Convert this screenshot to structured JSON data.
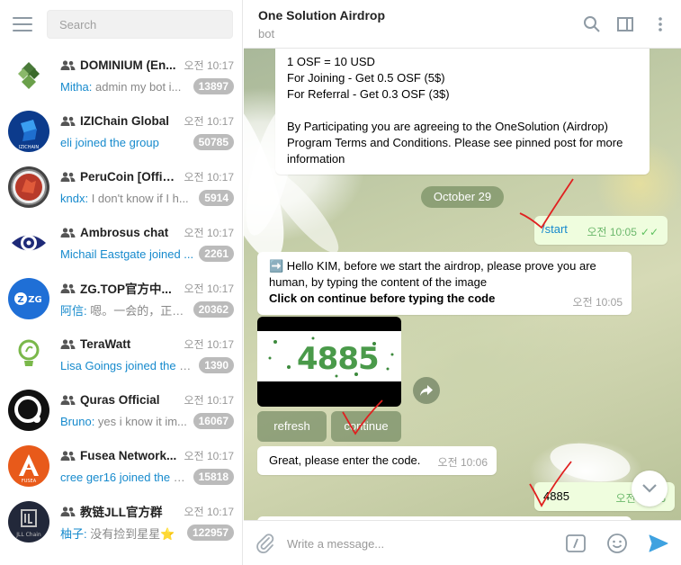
{
  "sidebar": {
    "search_placeholder": "Search",
    "chats": [
      {
        "name": "DOMINIUM (En...",
        "time": "오전 10:17",
        "who": "Mitha:",
        "preview": " admin my bot i...",
        "badge": "13897",
        "avatar": "dominium-logo"
      },
      {
        "name": "IZIChain Global",
        "time": "오전 10:17",
        "who": "",
        "preview": "eli joined the group",
        "badge": "50785",
        "avatar": "izichain-logo",
        "preview_link": true
      },
      {
        "name": "PeruCoin [Offic...",
        "time": "오전 10:17",
        "who": "kndx:",
        "preview": " I don't know if I h...",
        "badge": "5914",
        "avatar": "perucoin-logo"
      },
      {
        "name": "Ambrosus chat",
        "time": "오전 10:17",
        "who": "",
        "preview": "Michail Eastgate joined ...",
        "badge": "2261",
        "avatar": "ambrosus-logo",
        "preview_link": true
      },
      {
        "name": "ZG.TOP官方中...",
        "time": "오전 10:17",
        "who": "阿信:",
        "preview": " 嗯。一会的，正在...",
        "badge": "20362",
        "avatar": "zgtop-logo"
      },
      {
        "name": "TeraWatt",
        "time": "오전 10:17",
        "who": "",
        "preview": "Lisa Goings joined the g...",
        "badge": "1390",
        "avatar": "terawatt-logo",
        "preview_link": true
      },
      {
        "name": "Quras Official",
        "time": "오전 10:17",
        "who": "Bruno:",
        "preview": " yes i know it im...",
        "badge": "16067",
        "avatar": "quras-logo"
      },
      {
        "name": "Fusea Network...",
        "time": "오전 10:17",
        "who": "",
        "preview": "cree ger16 joined the g...",
        "badge": "15818",
        "avatar": "fusea-logo",
        "preview_link": true
      },
      {
        "name": "教链JLL官方群",
        "time": "오전 10:17",
        "who": "柚子:",
        "preview": " 没有捡到星星⭐",
        "badge": "122957",
        "avatar": "jllchain-logo"
      }
    ]
  },
  "header": {
    "title": "One Solution Airdrop",
    "subtitle": "bot"
  },
  "messages": {
    "intro_lines": [
      "1 OSF = 10 USD",
      "For Joining - Get  0.5 OSF (5$)",
      "For Referral - Get 0.3 OSF (3$)",
      "",
      "By Participating you are agreeing to the OneSolution (Airdrop)",
      "Program Terms and Conditions. Please see pinned post for more",
      "information"
    ],
    "date_divider": "October 29",
    "start": {
      "text": "/start",
      "time": "오전 10:05",
      "ticks": "✓✓"
    },
    "hello": {
      "emoji": "➡️",
      "line1": " Hello KIM, before we start the airdrop, please prove you are",
      "line2": "human, by typing the content of the image",
      "bold": "Click on continue before typing the code",
      "time": "오전 10:05"
    },
    "captcha_text": "4885",
    "buttons": {
      "refresh": "refresh",
      "continue": "continue"
    },
    "enter_code": {
      "text": "Great, please enter the code.",
      "time": "오전 10:06"
    },
    "code_reply": {
      "text": "4885",
      "time": "오전 10:06"
    }
  },
  "composer": {
    "placeholder": "Write a message..."
  },
  "colors": {
    "accent": "#168acd",
    "badge": "#bbbbbb",
    "out_bubble": "#effdde",
    "annotation": "#e02020"
  }
}
